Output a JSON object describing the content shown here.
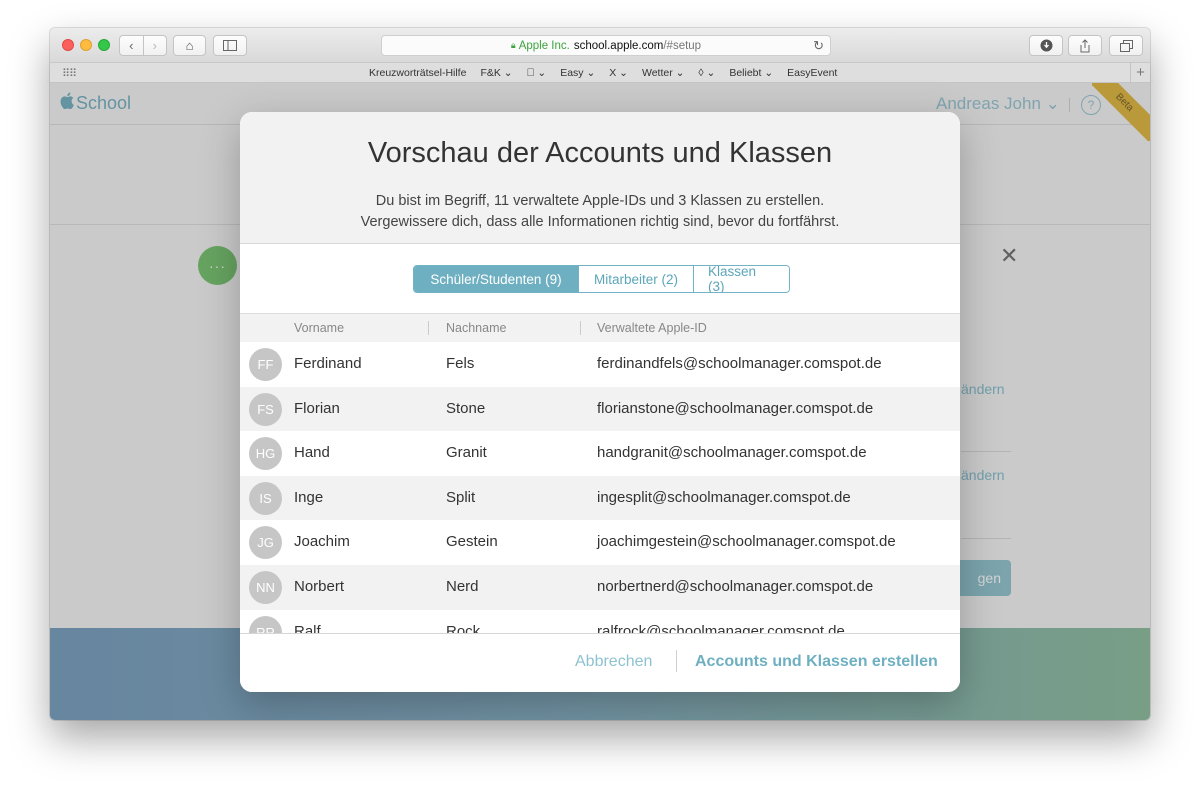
{
  "browser": {
    "url_org": "Apple Inc.",
    "url_domain": "school.apple.com",
    "url_path": "/#setup",
    "bookmarks": [
      "Kreuzworträtsel-Hilfe",
      "F&K ⌄",
      " ⌄",
      "Easy ⌄",
      "X ⌄",
      "Wetter ⌄",
      "◊ ⌄",
      "Beliebt ⌄",
      "EasyEvent"
    ]
  },
  "app": {
    "brand": "School",
    "user": "Andreas John ⌄",
    "help": "?",
    "beta": "Beta"
  },
  "background": {
    "dots": "···",
    "close": "✕",
    "link1": "ändern",
    "link2": "ändern",
    "button": "gen"
  },
  "modal": {
    "title": "Vorschau der Accounts und Klassen",
    "subtitle_line1": "Du bist im Begriff, 11 verwaltete Apple-IDs und 3 Klassen zu erstellen.",
    "subtitle_line2": "Vergewissere dich, dass alle Informationen richtig sind, bevor du fortfährst.",
    "tabs": [
      {
        "label": "Schüler/Studenten (9)",
        "active": true
      },
      {
        "label": "Mitarbeiter (2)",
        "active": false
      },
      {
        "label": "Klassen (3)",
        "active": false
      }
    ],
    "columns": [
      "Vorname",
      "Nachname",
      "Verwaltete Apple-ID"
    ],
    "rows": [
      {
        "initials": "FF",
        "first": "Ferdinand",
        "last": "Fels",
        "apple_id": "ferdinandfels@schoolmanager.comspot.de"
      },
      {
        "initials": "FS",
        "first": "Florian",
        "last": "Stone",
        "apple_id": "florianstone@schoolmanager.comspot.de"
      },
      {
        "initials": "HG",
        "first": "Hand",
        "last": "Granit",
        "apple_id": "handgranit@schoolmanager.comspot.de"
      },
      {
        "initials": "IS",
        "first": "Inge",
        "last": "Split",
        "apple_id": "ingesplit@schoolmanager.comspot.de"
      },
      {
        "initials": "JG",
        "first": "Joachim",
        "last": "Gestein",
        "apple_id": "joachimgestein@schoolmanager.comspot.de"
      },
      {
        "initials": "NN",
        "first": "Norbert",
        "last": "Nerd",
        "apple_id": "norbertnerd@schoolmanager.comspot.de"
      },
      {
        "initials": "RR",
        "first": "Ralf",
        "last": "Rock",
        "apple_id": "ralfrock@schoolmanager.comspot.de"
      }
    ],
    "cancel_label": "Abbrechen",
    "create_label": "Accounts und Klassen erstellen"
  }
}
